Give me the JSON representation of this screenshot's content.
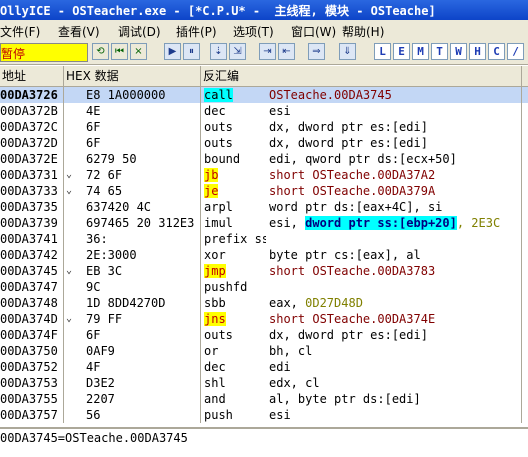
{
  "window": {
    "title": "OllyICE - OSTeacher.exe - [*C.P.U* -  主线程, 模块 - OSTeache]"
  },
  "menu": {
    "items": [
      "文件(F)",
      "查看(V)",
      "调试(D)",
      "插件(P)",
      "选项(T)",
      "窗口(W)",
      "帮助(H)"
    ]
  },
  "toolbar": {
    "status": "暂停",
    "buttons": [
      "⟲",
      "⏮",
      "×",
      "▶",
      "⏸",
      "⇣",
      "⇲",
      "⇥",
      "⇤",
      "⇒",
      "⇓"
    ],
    "letter_buttons": [
      "L",
      "E",
      "M",
      "T",
      "W",
      "H",
      "C",
      "/"
    ],
    "colors": {
      "status_bg": "#ffff00",
      "status_fg": "#c00000"
    }
  },
  "columns": {
    "address": "地址",
    "hex": "HEX 数据",
    "disasm": "反汇编"
  },
  "rows": [
    {
      "addr": "00DA3726",
      "arrow": "",
      "hex": "E8 1A000000",
      "mn": "call",
      "op": "OSTeache.00DA3745",
      "selected": true,
      "mn_bg": "",
      "hl": ""
    },
    {
      "addr": "00DA372B",
      "arrow": "",
      "hex": "4E",
      "mn": "dec",
      "op": "esi",
      "selected": false,
      "mn_bg": "",
      "hl": ""
    },
    {
      "addr": "00DA372C",
      "arrow": "",
      "hex": "6F",
      "mn": "outs",
      "op": "dx, dword ptr es:[edi]",
      "selected": false,
      "mn_bg": "",
      "hl": ""
    },
    {
      "addr": "00DA372D",
      "arrow": "",
      "hex": "6F",
      "mn": "outs",
      "op": "dx, dword ptr es:[edi]",
      "selected": false,
      "mn_bg": "",
      "hl": ""
    },
    {
      "addr": "00DA372E",
      "arrow": "",
      "hex": "6279 50",
      "mn": "bound",
      "op": "edi, qword ptr ds:[ecx+50]",
      "selected": false,
      "mn_bg": "",
      "hl": ""
    },
    {
      "addr": "00DA3731",
      "arrow": "⌄",
      "hex": "72 6F",
      "mn": "jb",
      "op": "short OSTeache.00DA37A2",
      "selected": false,
      "mn_bg": "#ffff00",
      "hl": ""
    },
    {
      "addr": "00DA3733",
      "arrow": "⌄",
      "hex": "74 65",
      "mn": "je",
      "op": "short OSTeache.00DA379A",
      "selected": false,
      "mn_bg": "#ffff00",
      "hl": ""
    },
    {
      "addr": "00DA3735",
      "arrow": "",
      "hex": "637420 4C",
      "mn": "arpl",
      "op": "word ptr ds:[eax+4C], si",
      "selected": false,
      "mn_bg": "",
      "hl": ""
    },
    {
      "addr": "00DA3739",
      "arrow": "",
      "hex": "697465 20 312E3",
      "mn": "imul",
      "op": "esi, dword ptr ss:[ebp+20], 2E3C",
      "selected": false,
      "mn_bg": "",
      "hl": "dword ptr ss:[ebp+20]"
    },
    {
      "addr": "00DA3741",
      "arrow": "",
      "hex": "36:",
      "mn": "prefix ss:",
      "op": "",
      "selected": false,
      "mn_bg": "",
      "hl": ""
    },
    {
      "addr": "00DA3742",
      "arrow": "",
      "hex": "2E:3000",
      "mn": "xor",
      "op": "byte ptr cs:[eax], al",
      "selected": false,
      "mn_bg": "",
      "hl": ""
    },
    {
      "addr": "00DA3745",
      "arrow": "⌄",
      "hex": "EB 3C",
      "mn": "jmp",
      "op": "short OSTeache.00DA3783",
      "selected": false,
      "mn_bg": "#ffff00",
      "hl": ""
    },
    {
      "addr": "00DA3747",
      "arrow": "",
      "hex": "9C",
      "mn": "pushfd",
      "op": "",
      "selected": false,
      "mn_bg": "",
      "hl": ""
    },
    {
      "addr": "00DA3748",
      "arrow": "",
      "hex": "1D 8DD4270D",
      "mn": "sbb",
      "op": "eax, 0D27D48D",
      "selected": false,
      "mn_bg": "",
      "hl": ""
    },
    {
      "addr": "00DA374D",
      "arrow": "⌄",
      "hex": "79 FF",
      "mn": "jns",
      "op": "short OSTeache.00DA374E",
      "selected": false,
      "mn_bg": "#ffff00",
      "hl": ""
    },
    {
      "addr": "00DA374F",
      "arrow": "",
      "hex": "6F",
      "mn": "outs",
      "op": "dx, dword ptr es:[edi]",
      "selected": false,
      "mn_bg": "",
      "hl": ""
    },
    {
      "addr": "00DA3750",
      "arrow": "",
      "hex": "0AF9",
      "mn": "or",
      "op": "bh, cl",
      "selected": false,
      "mn_bg": "",
      "hl": ""
    },
    {
      "addr": "00DA3752",
      "arrow": "",
      "hex": "4F",
      "mn": "dec",
      "op": "edi",
      "selected": false,
      "mn_bg": "",
      "hl": ""
    },
    {
      "addr": "00DA3753",
      "arrow": "",
      "hex": "D3E2",
      "mn": "shl",
      "op": "edx, cl",
      "selected": false,
      "mn_bg": "",
      "hl": ""
    },
    {
      "addr": "00DA3755",
      "arrow": "",
      "hex": "2207",
      "mn": "and",
      "op": "al, byte ptr ds:[edi]",
      "selected": false,
      "mn_bg": "",
      "hl": ""
    },
    {
      "addr": "00DA3757",
      "arrow": "",
      "hex": "56",
      "mn": "push",
      "op": "esi",
      "selected": false,
      "mn_bg": "",
      "hl": ""
    }
  ],
  "info": {
    "text": "00DA3745=OSTeache.00DA3745"
  },
  "colors": {
    "selected_row": "#c3d7f5",
    "jump_mnemonic_bg": "#ffff00",
    "jump_mnemonic_fg": "#c00000",
    "call_mnemonic_bg": "#00ffff",
    "operand_fg": "#800000",
    "address_fg": "#000000"
  }
}
